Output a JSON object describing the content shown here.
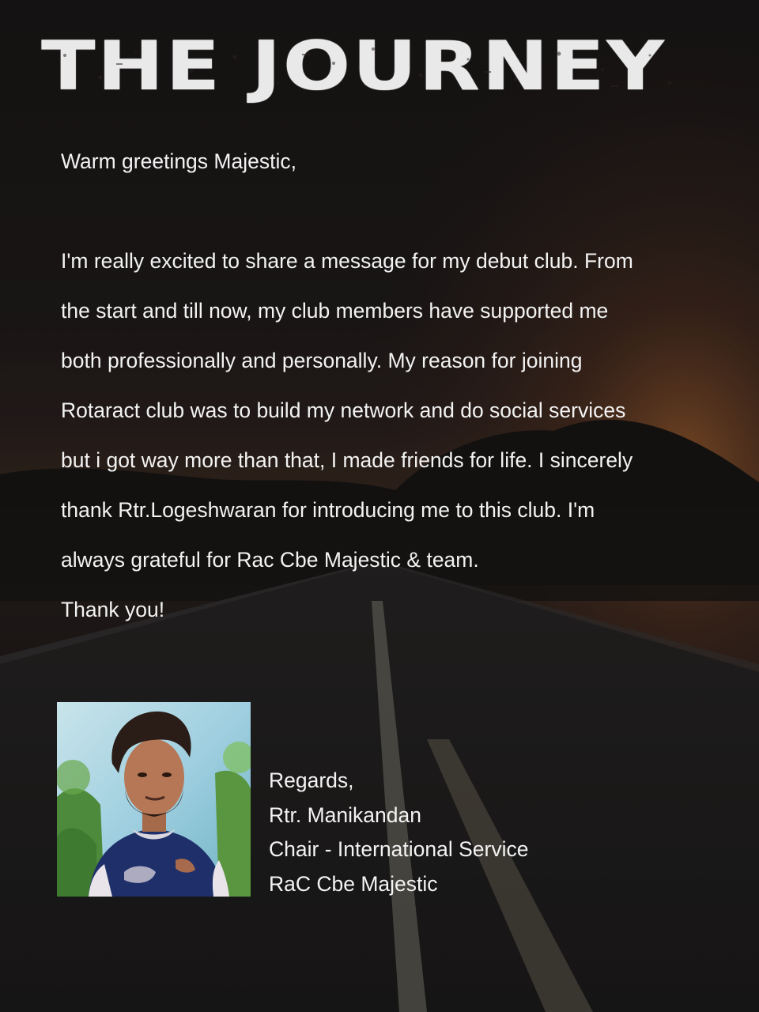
{
  "header": {
    "title": "THE JOURNEY"
  },
  "letter": {
    "greeting": "Warm greetings Majestic,",
    "lines": [
      "I'm really excited to share a message for my debut club. From",
      "the start and till now, my club members have supported me",
      "both professionally and personally. My reason for joining",
      "Rotaract club was to build my network and do social services",
      "but i got way more than that, I made friends for life. I sincerely",
      "thank Rtr.Logeshwaran for introducing me to this club. I'm",
      "always grateful for Rac Cbe Majestic & team.",
      "Thank you!"
    ]
  },
  "signature": {
    "closing": "Regards,",
    "name": "Rtr. Manikandan",
    "role": "Chair - International Service",
    "club": "RaC Cbe Majestic"
  }
}
